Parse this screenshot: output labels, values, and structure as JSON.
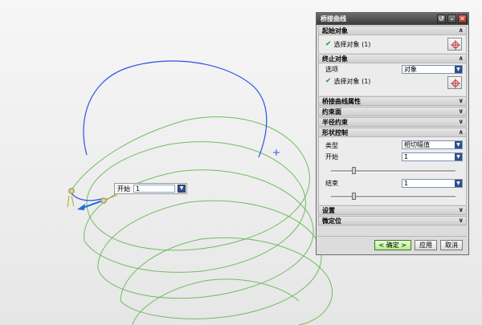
{
  "canvas": {
    "float_input": {
      "label": "开始",
      "value": "1",
      "icon": "arrow-stepper-icon"
    },
    "colors": {
      "helix": "#6fbd5f",
      "bridge_curve": "#2a52e6",
      "handle_vector": "#1f6fd6",
      "marker": "#8f8b3f"
    }
  },
  "dialog": {
    "title": "桥接曲线",
    "title_buttons": {
      "reset_icon": "reset-icon",
      "minimize_icon": "minimize-icon",
      "close_icon": "close-icon"
    },
    "start_object": {
      "header": "起始对象",
      "select_label": "选择对象 (1)",
      "pick_icon": "crosshair-icon"
    },
    "end_object": {
      "header": "终止对象",
      "option_label": "选项",
      "option_value": "对象",
      "select_label": "选择对象 (1)",
      "pick_icon": "crosshair-icon"
    },
    "collapsed_sections": [
      "桥接曲线属性",
      "约束面",
      "半径约束"
    ],
    "shape_control": {
      "header": "形状控制",
      "type_label": "类型",
      "type_value": "相切幅值",
      "start_label": "开始",
      "start_value": "1",
      "end_label": "结束",
      "end_value": "1",
      "start_slider_fraction": 0.18,
      "end_slider_fraction": 0.18
    },
    "bottom_sections": [
      "设置",
      "微定位"
    ],
    "buttons": {
      "ok": "< 确定 >",
      "apply": "应用",
      "cancel": "取消"
    }
  }
}
